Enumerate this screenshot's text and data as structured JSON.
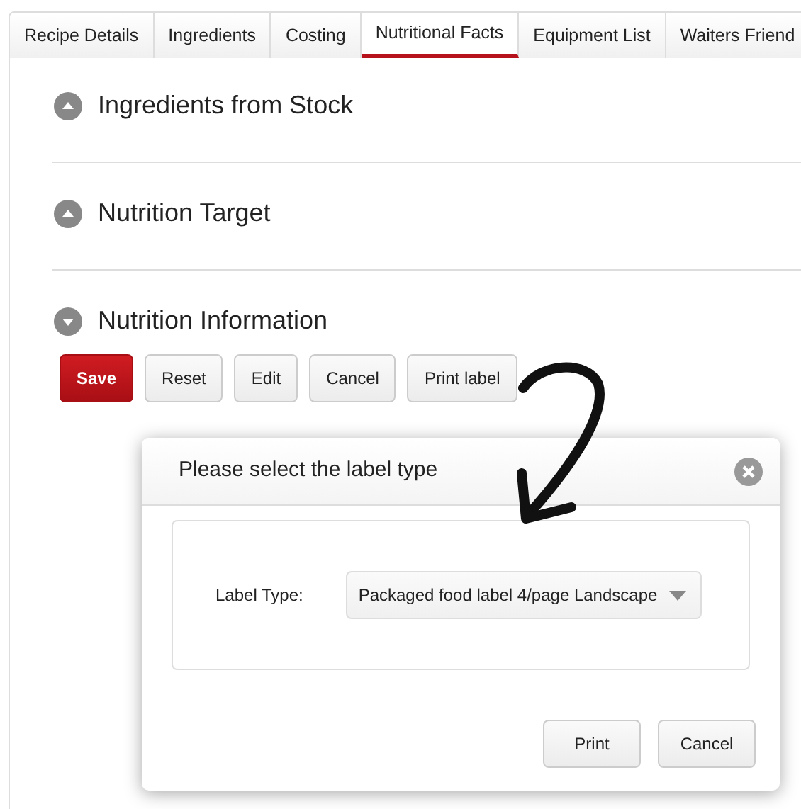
{
  "tabs": [
    {
      "label": "Recipe Details",
      "selected": false
    },
    {
      "label": "Ingredients",
      "selected": false
    },
    {
      "label": "Costing",
      "selected": false
    },
    {
      "label": "Nutritional Facts",
      "selected": true
    },
    {
      "label": "Equipment List",
      "selected": false
    },
    {
      "label": "Waiters Friend",
      "selected": false
    }
  ],
  "sections": [
    {
      "title": "Ingredients from Stock",
      "expanded": false
    },
    {
      "title": "Nutrition Target",
      "expanded": false
    },
    {
      "title": "Nutrition Information",
      "expanded": true
    }
  ],
  "actions": [
    {
      "label": "Save",
      "kind": "primary"
    },
    {
      "label": "Reset",
      "kind": "default"
    },
    {
      "label": "Edit",
      "kind": "default"
    },
    {
      "label": "Cancel",
      "kind": "default"
    },
    {
      "label": "Print label",
      "kind": "default"
    }
  ],
  "dialog": {
    "title": "Please select the label type",
    "field_label": "Label Type:",
    "field_value": "Packaged food label 4/page Landscape",
    "buttons": [
      "Print",
      "Cancel"
    ]
  }
}
